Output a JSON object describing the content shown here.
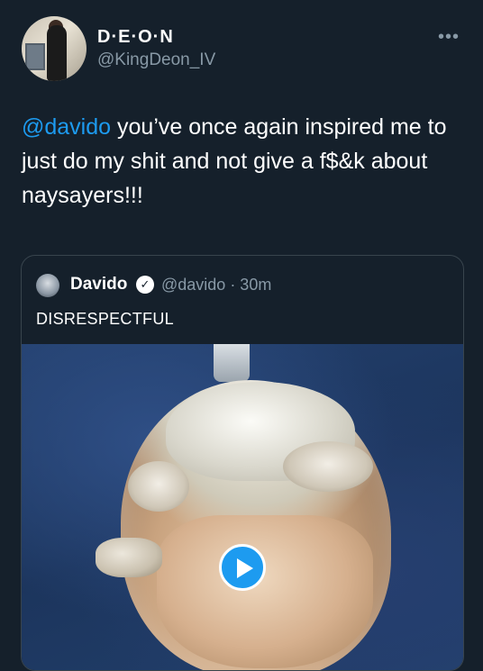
{
  "author": {
    "display_name": "D·E·O·N",
    "handle": "@KingDeon_IV",
    "avatar_icon": "profile-photo"
  },
  "menu_icon": "more-horizontal-icon",
  "tweet": {
    "mention": "@davido",
    "text_after_mention": " you’ve once again inspired me to just do my shit and not give a f$&k about naysayers!!!"
  },
  "quoted": {
    "name": "Davido",
    "handle_time": "@davido · 30m",
    "text": "DISRESPECTFUL",
    "media": "video-thumbnail",
    "play_icon": "play-icon"
  },
  "colors": {
    "background": "#15202b",
    "accent": "#1d9bf0",
    "secondary_text": "#8899a6",
    "border": "#38444d"
  }
}
